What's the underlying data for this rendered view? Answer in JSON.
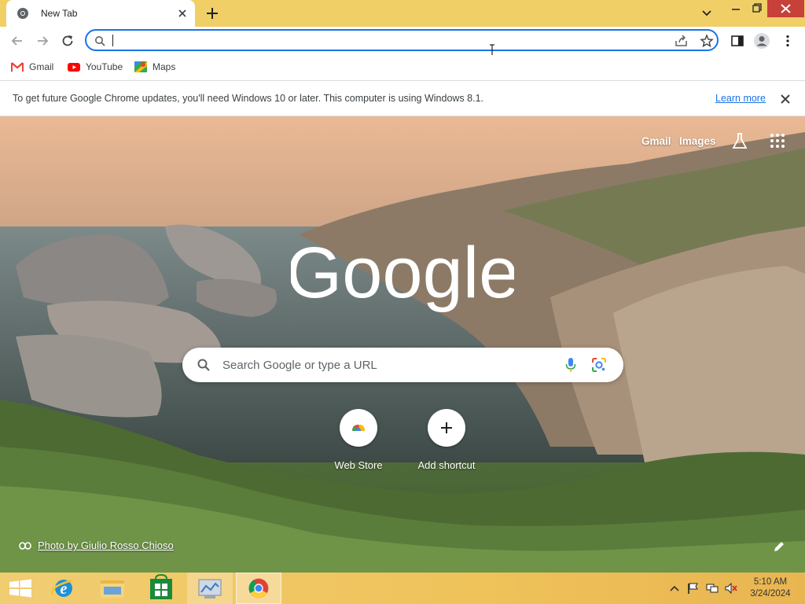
{
  "tab": {
    "title": "New Tab"
  },
  "bookmarks": [
    {
      "label": "Gmail",
      "icon": "gmail-icon"
    },
    {
      "label": "YouTube",
      "icon": "youtube-icon"
    },
    {
      "label": "Maps",
      "icon": "maps-icon"
    }
  ],
  "infobar": {
    "message": "To get future Google Chrome updates, you'll need Windows 10 or later. This computer is using Windows 8.1.",
    "link": "Learn more"
  },
  "ntp": {
    "gmail_link": "Gmail",
    "images_link": "Images",
    "search_placeholder": "Search Google or type a URL",
    "shortcuts": [
      {
        "label": "Web Store"
      },
      {
        "label": "Add shortcut"
      }
    ],
    "photo_credit": "Photo by Giulio Rosso Chioso"
  },
  "taskbar": {
    "time": "5:10 AM",
    "date": "3/24/2024"
  },
  "colors": {
    "accent": "#1a73e8",
    "tabstrip": "#f0cf67",
    "close_button": "#c7403a"
  }
}
